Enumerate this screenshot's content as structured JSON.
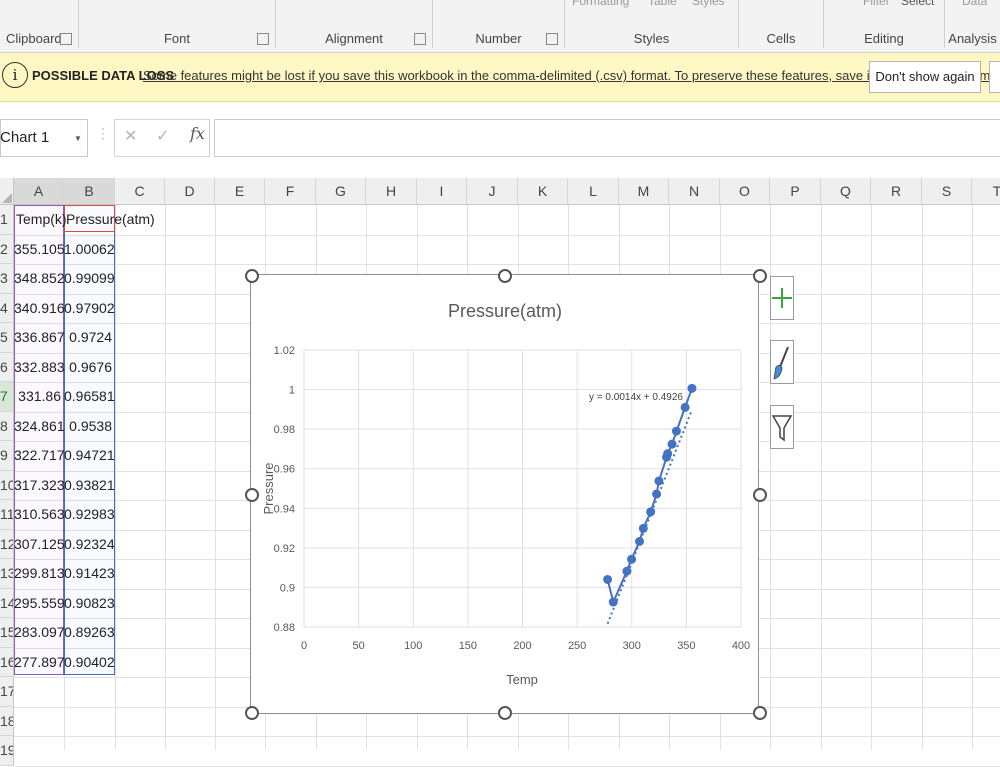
{
  "ribbon": {
    "groups": [
      "Clipboard",
      "Font",
      "Alignment",
      "Number",
      "Styles",
      "Cells",
      "Editing",
      "Analysis"
    ],
    "faded_labels": [
      "Formatting",
      "Table",
      "Styles",
      "Filter",
      "Select",
      "Data"
    ]
  },
  "message_bar": {
    "title": "POSSIBLE DATA LOSS",
    "text": "Some features might be lost if you save this workbook in the comma-delimited (.csv) format. To preserve these features, save it in an Excel file format.",
    "dont_show": "Don't show again"
  },
  "formula_bar": {
    "name_box": "Chart 1",
    "cancel": "✕",
    "enter": "✓",
    "fx": "fx",
    "value": ""
  },
  "columns": [
    "A",
    "B",
    "C",
    "D",
    "E",
    "F",
    "G",
    "H",
    "I",
    "J",
    "K",
    "L",
    "M",
    "N",
    "O",
    "P",
    "Q",
    "R",
    "S",
    "T"
  ],
  "rows": [
    "1",
    "2",
    "3",
    "4",
    "5",
    "6",
    "7",
    "8",
    "9",
    "10",
    "11",
    "12",
    "13",
    "14",
    "15",
    "16",
    "17",
    "18",
    "19"
  ],
  "table": {
    "headers": [
      "Temp(k)",
      "Pressure(atm)"
    ],
    "temp": [
      "355.105",
      "348.852",
      "340.916",
      "336.867",
      "332.883",
      "331.86",
      "324.861",
      "322.717",
      "317.323",
      "310.563",
      "307.125",
      "299.813",
      "295.559",
      "283.097",
      "277.897"
    ],
    "pressure": [
      "1.00062",
      "0.99099",
      "0.97902",
      "0.9724",
      "0.9676",
      "0.96581",
      "0.9538",
      "0.94721",
      "0.93821",
      "0.92983",
      "0.92324",
      "0.91423",
      "0.90823",
      "0.89263",
      "0.90402"
    ]
  },
  "chart_data": {
    "type": "scatter",
    "title": "Pressure(atm)",
    "xlabel": "Temp",
    "ylabel": "Pressure",
    "xlim": [
      0,
      400
    ],
    "ylim": [
      0.88,
      1.02
    ],
    "xticks": [
      "0",
      "50",
      "100",
      "150",
      "200",
      "250",
      "300",
      "350",
      "400"
    ],
    "yticks": [
      "0.88",
      "0.9",
      "0.92",
      "0.94",
      "0.96",
      "0.98",
      "1",
      "1.02"
    ],
    "grid": true,
    "x": [
      355.105,
      348.852,
      340.916,
      336.867,
      332.883,
      331.86,
      324.861,
      322.717,
      317.323,
      310.563,
      307.125,
      299.813,
      295.559,
      283.097,
      277.897
    ],
    "y": [
      1.00062,
      0.99099,
      0.97902,
      0.9724,
      0.9676,
      0.96581,
      0.9538,
      0.94721,
      0.93821,
      0.92983,
      0.92324,
      0.91423,
      0.90823,
      0.89263,
      0.90402
    ],
    "trendline": {
      "equation": "y = 0.0014x + 0.4926",
      "slope": 0.0014,
      "intercept": 0.4926,
      "style": "dotted"
    },
    "series_color": "#4472c4"
  },
  "chart_side_buttons": [
    "chart-elements-icon",
    "chart-styles-icon",
    "chart-filters-icon"
  ]
}
